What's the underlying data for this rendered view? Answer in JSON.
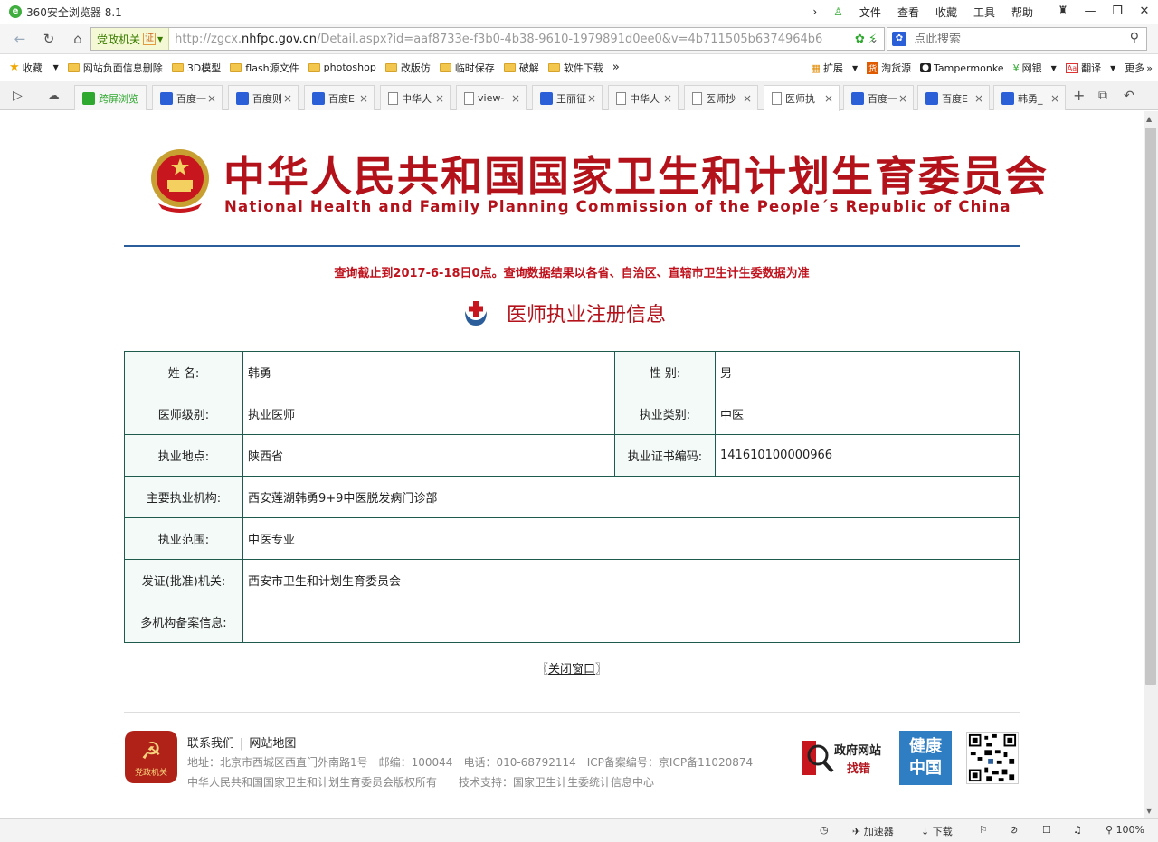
{
  "window": {
    "title": "360安全浏览器 8.1",
    "menus": [
      "文件",
      "查看",
      "收藏",
      "工具",
      "帮助"
    ]
  },
  "address": {
    "zone_label": "党政机关",
    "cert_label": "证",
    "url_host_prefix": "http://zgcx.",
    "url_host_main": "nhfpc.gov.cn",
    "url_path": "/Detail.aspx?id=aaf8733e-f3b0-4b38-9610-1979891d0ee0&v=4b711505b6374964b6",
    "search_placeholder": "点此搜索"
  },
  "bookmarks": {
    "favorites_label": "收藏",
    "items": [
      "网站负面信息删除",
      "3D模型",
      "flash源文件",
      "photoshop",
      "改版仿",
      "临时保存",
      "破解",
      "软件下载"
    ],
    "right_items": [
      "扩展",
      "淘货源",
      "Tampermonke",
      "网银",
      "翻译",
      "更多"
    ]
  },
  "tabs": {
    "items": [
      {
        "label": "跨屏浏览",
        "icon": "green"
      },
      {
        "label": "百度一",
        "icon": "paw"
      },
      {
        "label": "百度则",
        "icon": "paw"
      },
      {
        "label": "百度E",
        "icon": "paw"
      },
      {
        "label": "中华人",
        "icon": "doc"
      },
      {
        "label": "view-",
        "icon": "doc"
      },
      {
        "label": "王丽征",
        "icon": "paw"
      },
      {
        "label": "中华人",
        "icon": "doc"
      },
      {
        "label": "医师抄",
        "icon": "doc"
      },
      {
        "label": "医师执",
        "icon": "doc"
      },
      {
        "label": "百度一",
        "icon": "paw"
      },
      {
        "label": "百度E",
        "icon": "paw"
      },
      {
        "label": "韩勇_",
        "icon": "paw"
      }
    ]
  },
  "page": {
    "title_cn": "中华人民共和国国家卫生和计划生育委员会",
    "title_en": "National Health and Family Planning Commission of the People´s Republic of China",
    "notice": "查询截止到2017-6-18日0点。查询数据结果以各省、自治区、直辖市卫生计生委数据为准",
    "heading": "医师执业注册信息",
    "close_prefix": "〖",
    "close_label": "关闭窗口",
    "close_suffix": "〗"
  },
  "record": {
    "name_label": "姓 名:",
    "name": "韩勇",
    "gender_label": "性 别:",
    "gender": "男",
    "level_label": "医师级别:",
    "level": "执业医师",
    "category_label": "执业类别:",
    "category": "中医",
    "location_label": "执业地点:",
    "location": "陕西省",
    "cert_label": "执业证书编码:",
    "cert_no": "141610100000966",
    "institution_label": "主要执业机构:",
    "institution": "西安莲湖韩勇9+9中医脱发病门诊部",
    "scope_label": "执业范围:",
    "scope": "中医专业",
    "issuer_label": "发证(批准)机关:",
    "issuer": "西安市卫生和计划生育委员会",
    "multi_label": "多机构备案信息:",
    "multi": ""
  },
  "footer": {
    "party_badge_text": "党政机关",
    "contact": "联系我们",
    "sitemap": "网站地图",
    "link_sep": "|",
    "address": "地址：北京市西城区西直门外南路1号　邮编：100044　电话：010-68792114　ICP备案编号：京ICP备11020874",
    "copyright": "中华人民共和国国家卫生和计划生育委员会版权所有　　技术支持：国家卫生计生委统计信息中心",
    "gov_logo_line1": "政府网站",
    "gov_logo_line2": "找错",
    "health_logo": "健康中国"
  },
  "status": {
    "accelerator": "加速器",
    "download": "下载",
    "zoom": "100%"
  },
  "colors": {
    "brand_red": "#b3121b",
    "table_border": "#1f5b4d",
    "banner_rule": "#2a5d99"
  }
}
